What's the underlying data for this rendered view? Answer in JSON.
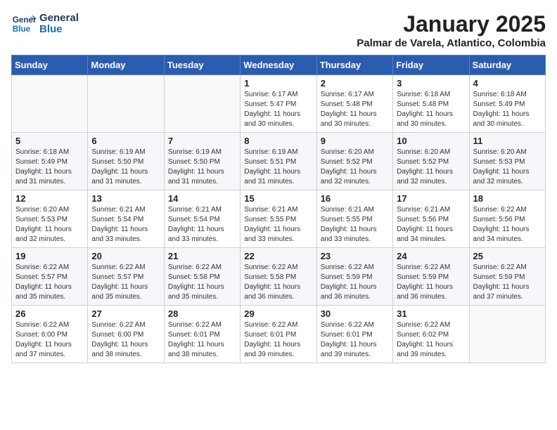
{
  "logo": {
    "line1": "General",
    "line2": "Blue"
  },
  "title": "January 2025",
  "subtitle": "Palmar de Varela, Atlantico, Colombia",
  "days_of_week": [
    "Sunday",
    "Monday",
    "Tuesday",
    "Wednesday",
    "Thursday",
    "Friday",
    "Saturday"
  ],
  "weeks": [
    [
      {
        "num": "",
        "info": ""
      },
      {
        "num": "",
        "info": ""
      },
      {
        "num": "",
        "info": ""
      },
      {
        "num": "1",
        "info": "Sunrise: 6:17 AM\nSunset: 5:47 PM\nDaylight: 11 hours and 30 minutes."
      },
      {
        "num": "2",
        "info": "Sunrise: 6:17 AM\nSunset: 5:48 PM\nDaylight: 11 hours and 30 minutes."
      },
      {
        "num": "3",
        "info": "Sunrise: 6:18 AM\nSunset: 5:48 PM\nDaylight: 11 hours and 30 minutes."
      },
      {
        "num": "4",
        "info": "Sunrise: 6:18 AM\nSunset: 5:49 PM\nDaylight: 11 hours and 30 minutes."
      }
    ],
    [
      {
        "num": "5",
        "info": "Sunrise: 6:18 AM\nSunset: 5:49 PM\nDaylight: 11 hours and 31 minutes."
      },
      {
        "num": "6",
        "info": "Sunrise: 6:19 AM\nSunset: 5:50 PM\nDaylight: 11 hours and 31 minutes."
      },
      {
        "num": "7",
        "info": "Sunrise: 6:19 AM\nSunset: 5:50 PM\nDaylight: 11 hours and 31 minutes."
      },
      {
        "num": "8",
        "info": "Sunrise: 6:19 AM\nSunset: 5:51 PM\nDaylight: 11 hours and 31 minutes."
      },
      {
        "num": "9",
        "info": "Sunrise: 6:20 AM\nSunset: 5:52 PM\nDaylight: 11 hours and 32 minutes."
      },
      {
        "num": "10",
        "info": "Sunrise: 6:20 AM\nSunset: 5:52 PM\nDaylight: 11 hours and 32 minutes."
      },
      {
        "num": "11",
        "info": "Sunrise: 6:20 AM\nSunset: 5:53 PM\nDaylight: 11 hours and 32 minutes."
      }
    ],
    [
      {
        "num": "12",
        "info": "Sunrise: 6:20 AM\nSunset: 5:53 PM\nDaylight: 11 hours and 32 minutes."
      },
      {
        "num": "13",
        "info": "Sunrise: 6:21 AM\nSunset: 5:54 PM\nDaylight: 11 hours and 33 minutes."
      },
      {
        "num": "14",
        "info": "Sunrise: 6:21 AM\nSunset: 5:54 PM\nDaylight: 11 hours and 33 minutes."
      },
      {
        "num": "15",
        "info": "Sunrise: 6:21 AM\nSunset: 5:55 PM\nDaylight: 11 hours and 33 minutes."
      },
      {
        "num": "16",
        "info": "Sunrise: 6:21 AM\nSunset: 5:55 PM\nDaylight: 11 hours and 33 minutes."
      },
      {
        "num": "17",
        "info": "Sunrise: 6:21 AM\nSunset: 5:56 PM\nDaylight: 11 hours and 34 minutes."
      },
      {
        "num": "18",
        "info": "Sunrise: 6:22 AM\nSunset: 5:56 PM\nDaylight: 11 hours and 34 minutes."
      }
    ],
    [
      {
        "num": "19",
        "info": "Sunrise: 6:22 AM\nSunset: 5:57 PM\nDaylight: 11 hours and 35 minutes."
      },
      {
        "num": "20",
        "info": "Sunrise: 6:22 AM\nSunset: 5:57 PM\nDaylight: 11 hours and 35 minutes."
      },
      {
        "num": "21",
        "info": "Sunrise: 6:22 AM\nSunset: 5:58 PM\nDaylight: 11 hours and 35 minutes."
      },
      {
        "num": "22",
        "info": "Sunrise: 6:22 AM\nSunset: 5:58 PM\nDaylight: 11 hours and 36 minutes."
      },
      {
        "num": "23",
        "info": "Sunrise: 6:22 AM\nSunset: 5:59 PM\nDaylight: 11 hours and 36 minutes."
      },
      {
        "num": "24",
        "info": "Sunrise: 6:22 AM\nSunset: 5:59 PM\nDaylight: 11 hours and 36 minutes."
      },
      {
        "num": "25",
        "info": "Sunrise: 6:22 AM\nSunset: 5:59 PM\nDaylight: 11 hours and 37 minutes."
      }
    ],
    [
      {
        "num": "26",
        "info": "Sunrise: 6:22 AM\nSunset: 6:00 PM\nDaylight: 11 hours and 37 minutes."
      },
      {
        "num": "27",
        "info": "Sunrise: 6:22 AM\nSunset: 6:00 PM\nDaylight: 11 hours and 38 minutes."
      },
      {
        "num": "28",
        "info": "Sunrise: 6:22 AM\nSunset: 6:01 PM\nDaylight: 11 hours and 38 minutes."
      },
      {
        "num": "29",
        "info": "Sunrise: 6:22 AM\nSunset: 6:01 PM\nDaylight: 11 hours and 39 minutes."
      },
      {
        "num": "30",
        "info": "Sunrise: 6:22 AM\nSunset: 6:01 PM\nDaylight: 11 hours and 39 minutes."
      },
      {
        "num": "31",
        "info": "Sunrise: 6:22 AM\nSunset: 6:02 PM\nDaylight: 11 hours and 39 minutes."
      },
      {
        "num": "",
        "info": ""
      }
    ]
  ]
}
